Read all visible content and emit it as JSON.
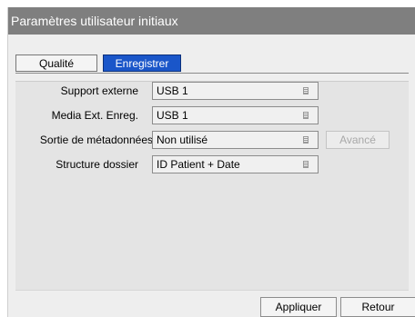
{
  "window": {
    "title": "Paramètres utilisateur initiaux"
  },
  "tabs": [
    {
      "label": "Qualité",
      "active": false
    },
    {
      "label": "Enregistrer",
      "active": true
    }
  ],
  "form": {
    "rows": [
      {
        "label": "Support externe",
        "value": "USB 1"
      },
      {
        "label": "Media Ext. Enreg.",
        "value": "USB 1"
      },
      {
        "label": "Sortie de métadonnées",
        "value": "Non utilisé"
      },
      {
        "label": "Structure dossier",
        "value": "ID Patient + Date"
      }
    ],
    "advanced_label": "Avancé",
    "advanced_enabled": false
  },
  "footer": {
    "apply_label": "Appliquer",
    "back_label": "Retour"
  },
  "colors": {
    "titlebar": "#7f7f7f",
    "active_tab": "#1a56c9",
    "panel": "#e4e4e4"
  }
}
